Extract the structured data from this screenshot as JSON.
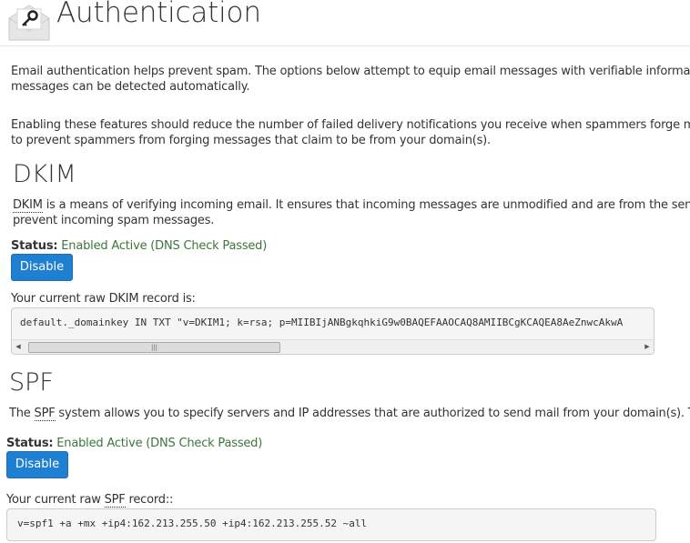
{
  "header": {
    "title": "Authentication",
    "icon": "envelope-key-icon"
  },
  "intro": {
    "p1_line1": "Email authentication helps prevent spam. The options below attempt to equip email messages with verifiable information so tha",
    "p1_line2": "messages can be detected automatically.",
    "p2_line1": "Enabling these features should reduce the number of failed delivery notifications you receive when spammers forge messages fr",
    "p2_line2": "to prevent spammers from forging messages that claim to be from your domain(s)."
  },
  "dkim": {
    "title": "DKIM",
    "abbr": "DKIM",
    "desc_line1_rest": " is a means of verifying incoming email. It ensures that incoming messages are unmodified and are from the sender from w",
    "desc_line2": "prevent incoming spam messages.",
    "status_label": "Status:",
    "status_value": "Enabled Active (DNS Check Passed)",
    "button_label": "Disable",
    "record_label": "Your current raw DKIM record is:",
    "record_value": "default._domainkey IN TXT \"v=DKIM1; k=rsa; p=MIIBIjANBgkqhkiG9w0BAQEFAAOCAQ8AMIIBCgKCAQEA8AeZnwcAkwA"
  },
  "spf": {
    "title": "SPF",
    "desc_pre": "The ",
    "abbr": "SPF",
    "desc_rest": " system allows you to specify servers and IP addresses that are authorized to send mail from your domain(s). This feature",
    "status_label": "Status:",
    "status_value": "Enabled Active (DNS Check Passed)",
    "button_label": "Disable",
    "record_label_pre": "Your current raw ",
    "record_abbr": "SPF",
    "record_label_post": " record::",
    "record_value": "v=spf1 +a +mx +ip4:162.213.255.50 +ip4:162.213.255.52 ~all"
  },
  "scrollbar": {
    "left_arrow": "◀",
    "right_arrow": "▶",
    "grip": "|||"
  },
  "colors": {
    "button": "#1f7fd1",
    "status_success": "#3c763d",
    "code_bg": "#f5f5f5"
  }
}
